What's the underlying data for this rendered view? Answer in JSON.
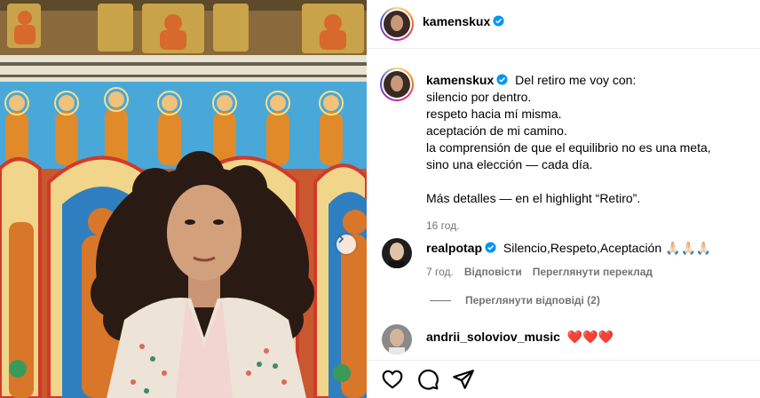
{
  "post": {
    "author": "kamenskux",
    "caption_lines": [
      "Del retiro me voy con:",
      "silencio por dentro.",
      "respeto hacia mí misma.",
      "aceptación de mi camino.",
      "la comprensión de que el equilibrio no es una meta,",
      "sino una elección — cada día.",
      "",
      "Más detalles — en el highlight “Retiro”."
    ],
    "time": "16 год."
  },
  "comments": [
    {
      "author": "realpotap",
      "text": "Silencio,Respeto,Aceptación 🙏🏻🙏🏻🙏🏻",
      "time": "7 год.",
      "reply_label": "Відповісти",
      "translate_label": "Переглянути переклад",
      "view_replies": "Переглянути відповіді (2)"
    },
    {
      "author": "andrii_soloviov_music",
      "text": "❤️❤️❤️"
    }
  ],
  "icons": {
    "verified": "verified-badge-icon",
    "like": "heart-icon",
    "comment": "comment-icon",
    "share": "paper-plane-icon",
    "next": "chevron-right-icon"
  },
  "colors": {
    "verified": "#0095f6",
    "meta": "#737373",
    "divider": "#efefef"
  }
}
